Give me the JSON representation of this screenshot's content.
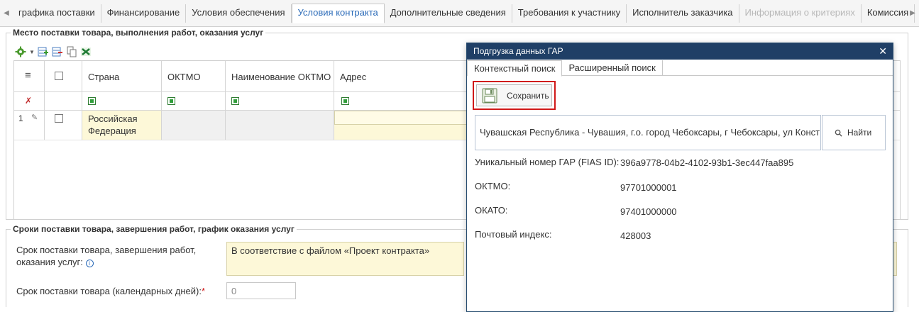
{
  "tabs": {
    "items": [
      {
        "label": "графика поставки",
        "state": "normal"
      },
      {
        "label": "Финансирование",
        "state": "normal"
      },
      {
        "label": "Условия обеспечения",
        "state": "normal"
      },
      {
        "label": "Условия контракта",
        "state": "active"
      },
      {
        "label": "Дополнительные сведения",
        "state": "normal"
      },
      {
        "label": "Требования к участнику",
        "state": "normal"
      },
      {
        "label": "Исполнитель заказчика",
        "state": "normal"
      },
      {
        "label": "Информация о критериях",
        "state": "disabled"
      },
      {
        "label": "Комиссия",
        "state": "normal"
      }
    ]
  },
  "delivery_place": {
    "title": "Место поставки товара, выполнения работ, оказания услуг",
    "columns": [
      "Страна",
      "ОКТМО",
      "Наименование ОКТМО",
      "Адрес"
    ],
    "rows": [
      {
        "num": "1",
        "country_line1": "Российская",
        "country_line2": "Федерация",
        "oktmo": "",
        "oktmo_name": "",
        "address": ""
      }
    ]
  },
  "delivery_terms": {
    "title": "Сроки поставки товара, завершения работ, график оказания услуг",
    "term_label_line1": "Срок поставки товара, завершения работ,",
    "term_label_line2": "оказания услуг:",
    "term_value": "В соответствие с файлом «Проект контракта»",
    "days_label": "Срок поставки товара (календарных дней):",
    "required_mark": "*",
    "days_value": "0"
  },
  "dialog": {
    "title": "Подгрузка данных ГАР",
    "close_glyph": "✕",
    "tabs": [
      "Контекстный поиск",
      "Расширенный поиск"
    ],
    "save_label": "Сохранить",
    "search_value": "Чувашская Республика - Чувашия, г.о. город Чебоксары, г Чебоксары, ул Конст",
    "find_label": "Найти",
    "fields": [
      {
        "label": "Уникальный номер ГАР (FIAS ID):",
        "value": "396a9778-04b2-4102-93b1-3ec447faa895"
      },
      {
        "label": "ОКТМО:",
        "value": "97701000001"
      },
      {
        "label": "ОКАТО:",
        "value": "97401000000"
      },
      {
        "label": "Почтовый индекс:",
        "value": "428003"
      }
    ]
  },
  "colors": {
    "accent": "#2a6ab8",
    "dialog_header": "#1f3f66",
    "highlight": "#d01818",
    "readonly_bg": "#fdf8d8"
  }
}
